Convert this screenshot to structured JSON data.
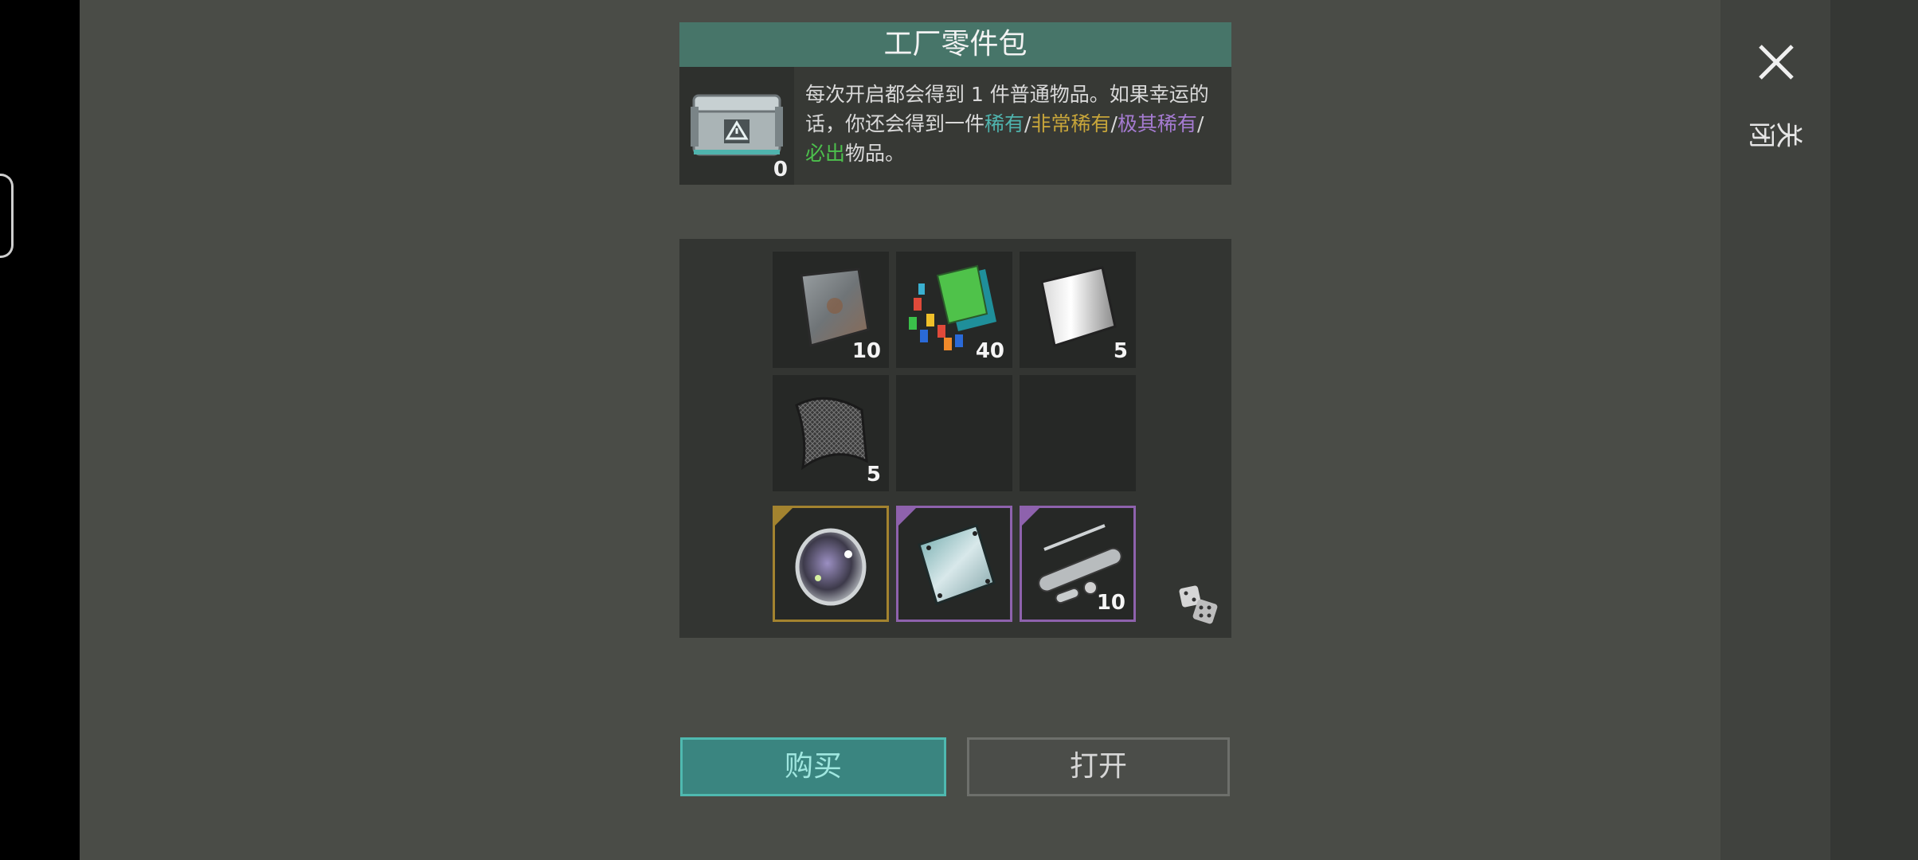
{
  "header": {
    "title": "工厂零件包"
  },
  "close": {
    "label": "关闭"
  },
  "crate": {
    "count": "0"
  },
  "description": {
    "text1": "每次开启都会得到 1 件普通物品。如果幸运的话，你还会得到一件",
    "rare": "稀有",
    "sep1": "/",
    "very_rare": "非常稀有",
    "sep2": "/",
    "epic": "极其稀有",
    "sep3": "/",
    "guaranteed": "必出",
    "text2": "物品。"
  },
  "items": {
    "slot1": {
      "icon": "scrap-metal-icon",
      "qty": "10"
    },
    "slot2": {
      "icon": "wires-and-plastic-icon",
      "qty": "40"
    },
    "slot3": {
      "icon": "sheet-metal-icon",
      "qty": "5"
    },
    "slot4": {
      "icon": "mesh-fabric-icon",
      "qty": "5"
    },
    "slot5": {
      "icon": "empty",
      "qty": ""
    },
    "slot6": {
      "icon": "empty",
      "qty": ""
    },
    "slot7": {
      "icon": "lens-icon",
      "qty": "",
      "rarity": "very-rare"
    },
    "slot8": {
      "icon": "metal-plate-icon",
      "qty": "",
      "rarity": "epic"
    },
    "slot9": {
      "icon": "metal-pipes-icon",
      "qty": "10",
      "rarity": "epic"
    }
  },
  "buttons": {
    "buy": "购买",
    "open": "打开"
  },
  "colors": {
    "header": "#477569",
    "rare": "#4fb3ad",
    "very_rare": "#c7a53a",
    "epic": "#a57bd1",
    "guaranteed": "#4cc04c",
    "buy_button": "#3a8580"
  }
}
